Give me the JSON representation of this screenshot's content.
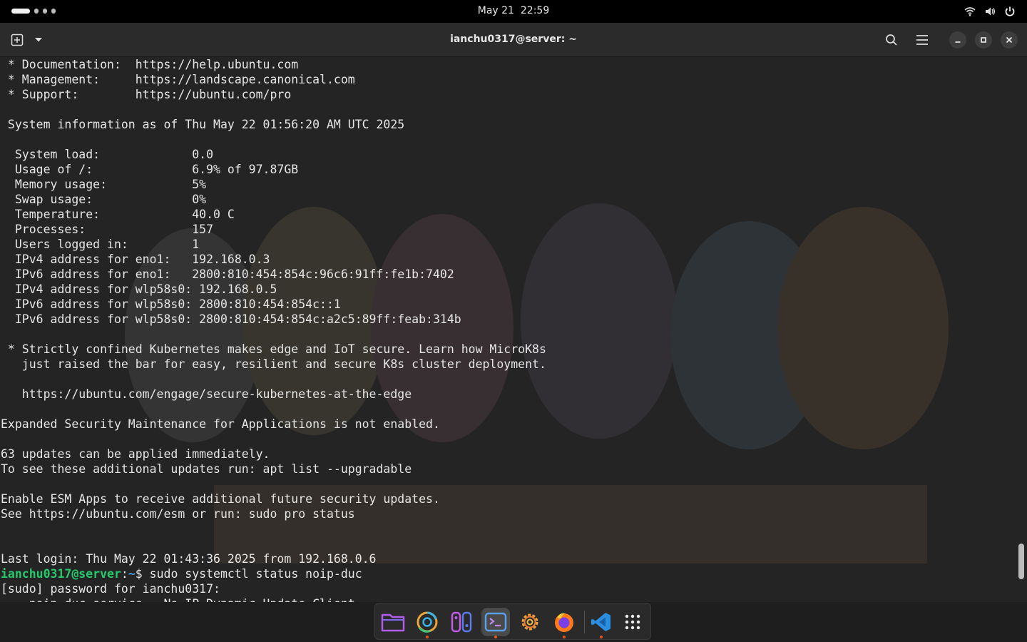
{
  "topbar": {
    "date": "May 21",
    "time": "22:59"
  },
  "window": {
    "title": "ianchu0317@server: ~"
  },
  "terminal": {
    "lines": [
      " * Documentation:  https://help.ubuntu.com",
      " * Management:     https://landscape.canonical.com",
      " * Support:        https://ubuntu.com/pro",
      "",
      " System information as of Thu May 22 01:56:20 AM UTC 2025",
      "",
      "  System load:             0.0",
      "  Usage of /:              6.9% of 97.87GB",
      "  Memory usage:            5%",
      "  Swap usage:              0%",
      "  Temperature:             40.0 C",
      "  Processes:               157",
      "  Users logged in:         1",
      "  IPv4 address for eno1:   192.168.0.3",
      "  IPv6 address for eno1:   2800:810:454:854c:96c6:91ff:fe1b:7402",
      "  IPv4 address for wlp58s0: 192.168.0.5",
      "  IPv6 address for wlp58s0: 2800:810:454:854c::1",
      "  IPv6 address for wlp58s0: 2800:810:454:854c:a2c5:89ff:feab:314b",
      "",
      " * Strictly confined Kubernetes makes edge and IoT secure. Learn how MicroK8s",
      "   just raised the bar for easy, resilient and secure K8s cluster deployment.",
      "",
      "   https://ubuntu.com/engage/secure-kubernetes-at-the-edge",
      "",
      "Expanded Security Maintenance for Applications is not enabled.",
      "",
      "63 updates can be applied immediately.",
      "To see these additional updates run: apt list --upgradable",
      "",
      "Enable ESM Apps to receive additional future security updates.",
      "See https://ubuntu.com/esm or run: sudo pro status",
      "",
      "",
      "Last login: Thu May 22 01:43:36 2025 from 192.168.0.6"
    ],
    "prompt_user": "ianchu0317@server",
    "prompt_sep": ":",
    "prompt_path": "~",
    "prompt_symbol": "$ ",
    "command": "sudo systemctl status noip-duc",
    "sudo_line": "[sudo] password for ianchu0317:",
    "partial_line": "    noip-duc.service - No-IP Dynamic Update Client"
  },
  "dock": {
    "apps": [
      "files",
      "chrome",
      "flatseal",
      "terminal",
      "settings",
      "firefox",
      "vscode",
      "app-grid"
    ]
  },
  "colors": {
    "prompt_user": "#26c86c",
    "prompt_path": "#3ea0e8",
    "accent_dot": "#e95420"
  }
}
